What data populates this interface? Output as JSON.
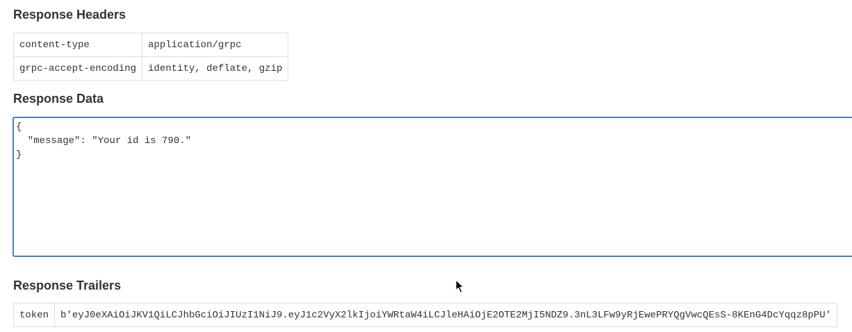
{
  "headers_section": {
    "title": "Response Headers",
    "rows": [
      {
        "key": "content-type",
        "value": "application/grpc"
      },
      {
        "key": "grpc-accept-encoding",
        "value": "identity, deflate, gzip"
      }
    ]
  },
  "data_section": {
    "title": "Response Data",
    "content": "{\n  \"message\": \"Your id is 790.\"\n}"
  },
  "trailers_section": {
    "title": "Response Trailers",
    "rows": [
      {
        "key": "token",
        "value": "b'eyJ0eXAiOiJKV1QiLCJhbGciOiJIUzI1NiJ9.eyJ1c2VyX2lkIjoiYWRtaW4iLCJleHAiOjE2OTE2MjI5NDZ9.3nL3LFw9yRjEwePRYQgVwcQEsS-8KEnG4DcYqqz8pPU'"
      }
    ]
  },
  "colors": {
    "accent_border": "#4a7ebf",
    "table_border": "#dddddd",
    "text": "#333333"
  },
  "icons": {
    "cursor": "mouse-pointer-icon"
  }
}
